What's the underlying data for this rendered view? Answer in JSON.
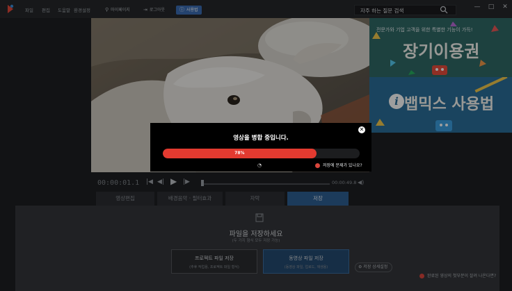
{
  "menu": {
    "items": [
      "파일",
      "편집",
      "도움말",
      "환경설정"
    ],
    "mypage": "마이페이지",
    "logout": "로그아웃",
    "user_guide": "사용법"
  },
  "search": {
    "value": "자주 하는 질문 검색"
  },
  "window_controls": [
    "—",
    "□",
    "✕"
  ],
  "ad": {
    "tagline": "전문가와 기업 고객을 위한 특별한 기능이 가득!",
    "headline": "장기이용권",
    "howto": "뱁믹스 사용법",
    "info_glyph": "i"
  },
  "player": {
    "current_time": "00:00:01.1",
    "duration": "00:00:49.8",
    "controls": [
      "|◀",
      "◀|",
      "▶",
      "|▶"
    ]
  },
  "tabs": [
    {
      "label": "영상편집",
      "active": false
    },
    {
      "label": "배경음악 · 필터효과",
      "active": false
    },
    {
      "label": "자막",
      "active": false
    },
    {
      "label": "저장",
      "active": true
    }
  ],
  "save_panel": {
    "title": "파일을 저장하세요",
    "subtitle": "(두 가지 형식 모두 저장 가능)",
    "project_button": {
      "title": "프로젝트 파일 저장",
      "sub": "(추후 작업용, 프로젝트 파일 형식)"
    },
    "video_button": {
      "title": "동영상 파일 저장",
      "sub": "(동영상 파일, 업로드, 재생용)"
    },
    "settings_label": "저장 상세설정",
    "help_link": "완료된 영상의 첫부분이 잘려 나온다면?"
  },
  "modal": {
    "title": "영상을 병합 중입니다.",
    "progress_percent": 78,
    "progress_label": "78%",
    "problem_link": "저장에 문제가 있나요?",
    "close_glyph": "✕"
  },
  "colors": {
    "accent": "#2e5f94",
    "progress": "#e33a30",
    "warning": "#d9463c"
  }
}
